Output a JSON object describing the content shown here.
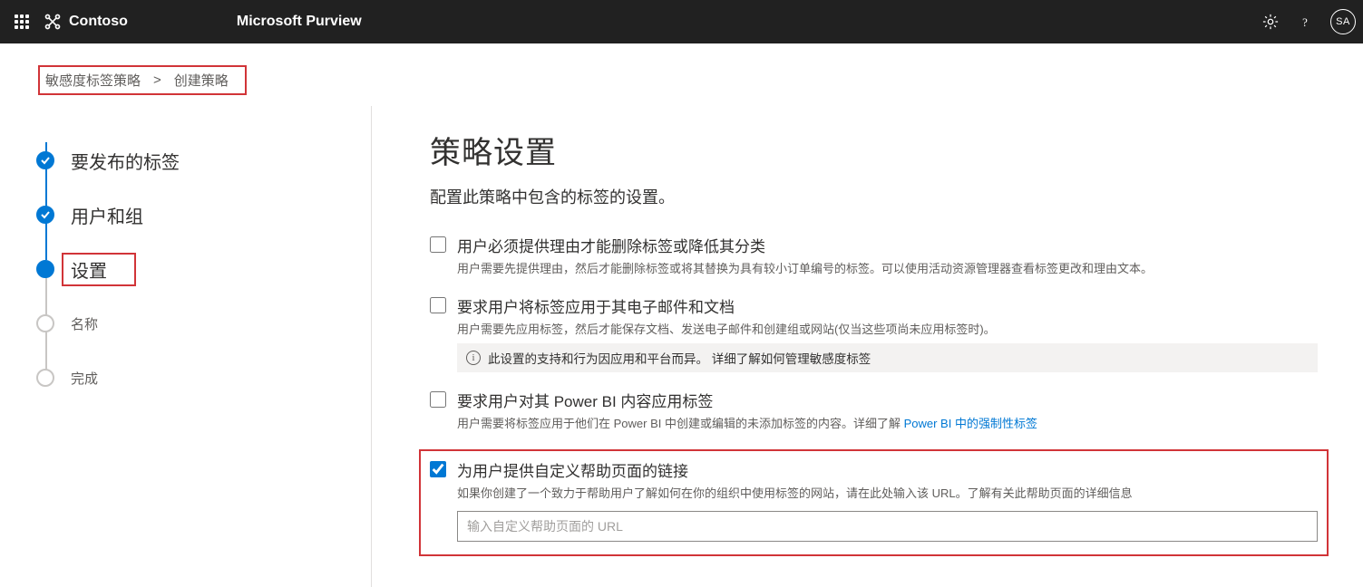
{
  "header": {
    "brand": "Contoso",
    "product": "Microsoft Purview",
    "avatar": "SA"
  },
  "breadcrumb": {
    "parent": "敏感度标签策略",
    "separator": ">",
    "current": "创建策略"
  },
  "steps": [
    {
      "label": "要发布的标签",
      "state": "done"
    },
    {
      "label": "用户和组",
      "state": "done"
    },
    {
      "label": "设置",
      "state": "current"
    },
    {
      "label": "名称",
      "state": "pending"
    },
    {
      "label": "完成",
      "state": "pending"
    }
  ],
  "content": {
    "title": "策略设置",
    "subtitle": "配置此策略中包含的标签的设置。",
    "option1": {
      "title": "用户必须提供理由才能删除标签或降低其分类",
      "desc": "用户需要先提供理由，然后才能删除标签或将其替换为具有较小订单编号的标签。可以使用活动资源管理器查看标签更改和理由文本。"
    },
    "option2": {
      "title": "要求用户将标签应用于其电子邮件和文档",
      "desc": "用户需要先应用标签，然后才能保存文档、发送电子邮件和创建组或网站(仅当这些项尚未应用标签时)。",
      "info_text": "此设置的支持和行为因应用和平台而异。",
      "info_link": "详细了解如何管理敏感度标签"
    },
    "option3": {
      "title": "要求用户对其 Power BI 内容应用标签",
      "desc_a": "用户需要将标签应用于他们在 Power BI 中创建或编辑的未添加标签的内容。详细了解 ",
      "desc_link": "Power BI 中的强制性标签"
    },
    "option4": {
      "title": "为用户提供自定义帮助页面的链接",
      "desc": "如果你创建了一个致力于帮助用户了解如何在你的组织中使用标签的网站，请在此处输入该 URL。了解有关此帮助页面的详细信息",
      "placeholder": "输入自定义帮助页面的 URL"
    }
  }
}
